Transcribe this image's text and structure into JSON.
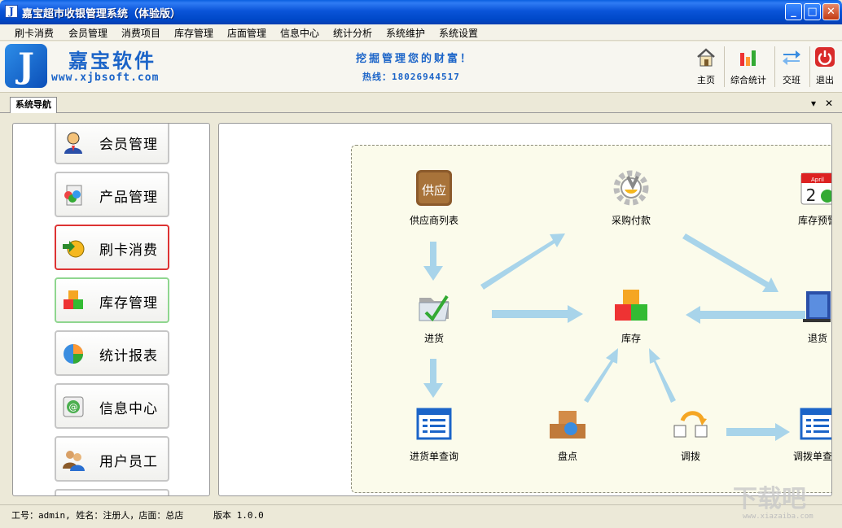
{
  "window": {
    "title": "嘉宝超市收银管理系统（体验版）",
    "icon_glyph": "J",
    "buttons": [
      "_",
      "□",
      "✕"
    ]
  },
  "menu": [
    "刷卡消费",
    "会员管理",
    "消费项目",
    "库存管理",
    "店面管理",
    "信息中心",
    "统计分析",
    "系统维护",
    "系统设置"
  ],
  "header": {
    "logo_glyph": "J",
    "logo_cn": "嘉宝软件",
    "logo_url": "www.xjbsoft.com",
    "slogan": "挖掘管理您的财富！",
    "hotline": "热线：18026944517"
  },
  "toolbar": [
    "主页",
    "综合统计",
    "交班",
    "退出"
  ],
  "nav_tab": {
    "label": "系统导航",
    "dropdown_glyph": "▾",
    "close_glyph": "✕"
  },
  "nav_items": [
    {
      "label": "会员管理",
      "state": "normal"
    },
    {
      "label": "产品管理",
      "state": "normal"
    },
    {
      "label": "刷卡消费",
      "state": "active"
    },
    {
      "label": "库存管理",
      "state": "hover"
    },
    {
      "label": "统计报表",
      "state": "normal"
    },
    {
      "label": "信息中心",
      "state": "normal"
    },
    {
      "label": "用户员工",
      "state": "normal"
    }
  ],
  "flow_nodes": {
    "supplier": "供应商列表",
    "supplier_icon_text": "供应",
    "payment": "采购付款",
    "stock_warning": "库存预警",
    "stock_warning_day": "2",
    "stock_warning_month": "April",
    "purchase": "进货",
    "inventory": "库存",
    "return": "退货",
    "purchase_query": "进货单查询",
    "stocktake": "盘点",
    "transfer": "调拨",
    "transfer_query": "调拨单查询"
  },
  "status": {
    "user": "工号：admin, 姓名：注册人，店面：总店",
    "version": "版本 1.0.0"
  },
  "watermark": {
    "text": "下载吧",
    "url": "www.xiazaiba.com"
  },
  "colors": {
    "titlebar": "#0a54d8",
    "brand_blue": "#1b64c8",
    "arrow": "#a8d4ea",
    "active_border": "#dd3333",
    "hover_border": "#8fd68f"
  }
}
